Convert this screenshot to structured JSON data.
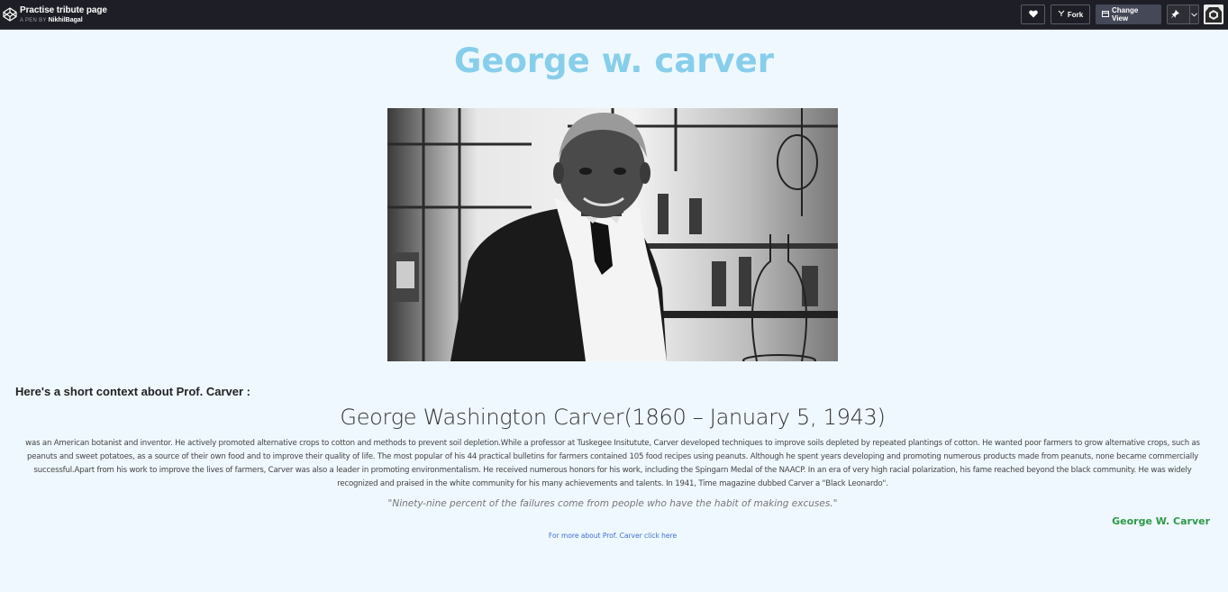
{
  "topbar": {
    "pen_title": "Practise tribute page",
    "pen_by_prefix": "A PEN BY",
    "author": "NikhilBagal",
    "fork_label": "Fork",
    "change_view_label": "Change View"
  },
  "page": {
    "title": "George w. carver",
    "context_heading": "Here's a short context about Prof. Carver :",
    "bio_name": "George Washington Carver(1860 – January 5, 1943)",
    "bio_text": "was an American botanist and inventor. He actively promoted alternative crops to cotton and methods to prevent soil depletion.While a professor at Tuskegee Insitutute, Carver developed techniques to improve soils depleted by repeated plantings of cotton. He wanted poor farmers to grow alternative crops, such as peanuts and sweet potatoes, as a source of their own food and to improve their quality of life. The most popular of his 44 practical bulletins for farmers contained 105 food recipes using peanuts. Although he spent years developing and promoting numerous products made from peanuts, none became commercially successful.Apart from his work to improve the lives of farmers, Carver was also a leader in promoting environmentalism. He received numerous honors for his work, including the Spingarn Medal of the NAACP. In an era of very high racial polarization, his fame reached beyond the black community. He was widely recognized and praised in the white community for his many achievements and talents. In 1941, Time magazine dubbed Carver a \"Black Leonardo\".",
    "quote": "\"Ninety-nine percent of the failures come from people who have the habit of making excuses.\"",
    "quote_author": "George W. Carver",
    "more_link": "For more about Prof. Carver click here"
  },
  "colors": {
    "title": "#87ceeb",
    "background": "#eff8fe",
    "quote_author": "#2e9a47",
    "link": "#3f6fd6",
    "topbar": "#1e1f26"
  },
  "icons": {
    "logo": "codepen-logo-icon",
    "heart": "heart-icon",
    "fork": "fork-icon",
    "change_view": "layout-icon",
    "pin": "pin-icon",
    "caret": "chevron-down-icon",
    "avatar": "user-avatar"
  }
}
